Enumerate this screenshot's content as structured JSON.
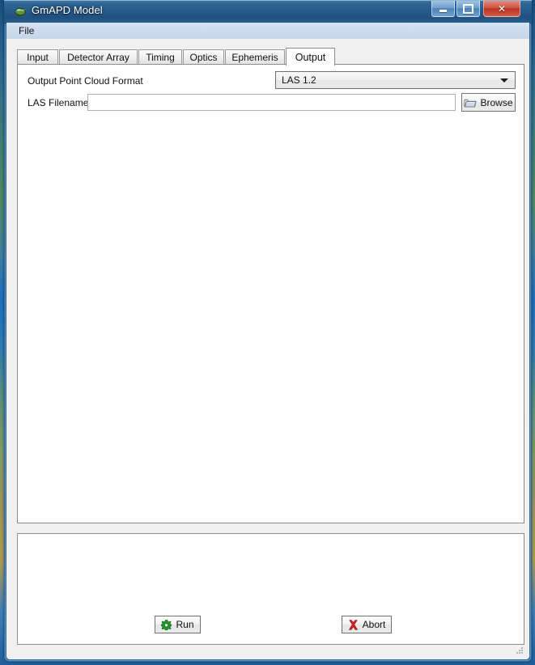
{
  "window": {
    "title": "GmAPD Model",
    "app_icon": "globe-icon",
    "controls": {
      "minimize": {
        "label": "Minimize",
        "icon": "minimize-icon"
      },
      "maximize": {
        "label": "Maximize",
        "icon": "maximize-icon"
      },
      "close": {
        "label": "Close",
        "icon": "close-icon",
        "glyph": "✕",
        "color": "#c0392b"
      }
    }
  },
  "menubar": {
    "items": [
      {
        "label": "File"
      }
    ]
  },
  "tabs": {
    "active_index": 5,
    "items": [
      {
        "label": "Input",
        "name": "tab-input"
      },
      {
        "label": "Detector Array",
        "name": "tab-detector-array"
      },
      {
        "label": "Timing",
        "name": "tab-timing"
      },
      {
        "label": "Optics",
        "name": "tab-optics"
      },
      {
        "label": "Ephemeris",
        "name": "tab-ephemeris"
      },
      {
        "label": "Output",
        "name": "tab-output"
      }
    ]
  },
  "output_tab": {
    "format_row": {
      "label": "Output Point Cloud Format",
      "selected": "LAS 1.2",
      "options": [
        "LAS 1.2"
      ],
      "icon": "chevron-down-icon"
    },
    "filename_row": {
      "label": "LAS Filename",
      "value": "",
      "placeholder": "",
      "browse": {
        "label": "Browse",
        "icon": "folder-icon"
      }
    }
  },
  "log_panel": {
    "text": ""
  },
  "actions": {
    "run": {
      "label": "Run",
      "icon": "gear-icon",
      "icon_color": "#1e9e28"
    },
    "abort": {
      "label": "Abort",
      "icon": "red-x-icon",
      "icon_color": "#d42027"
    }
  },
  "resize_grip": {
    "icon": "resize-grip-icon"
  }
}
